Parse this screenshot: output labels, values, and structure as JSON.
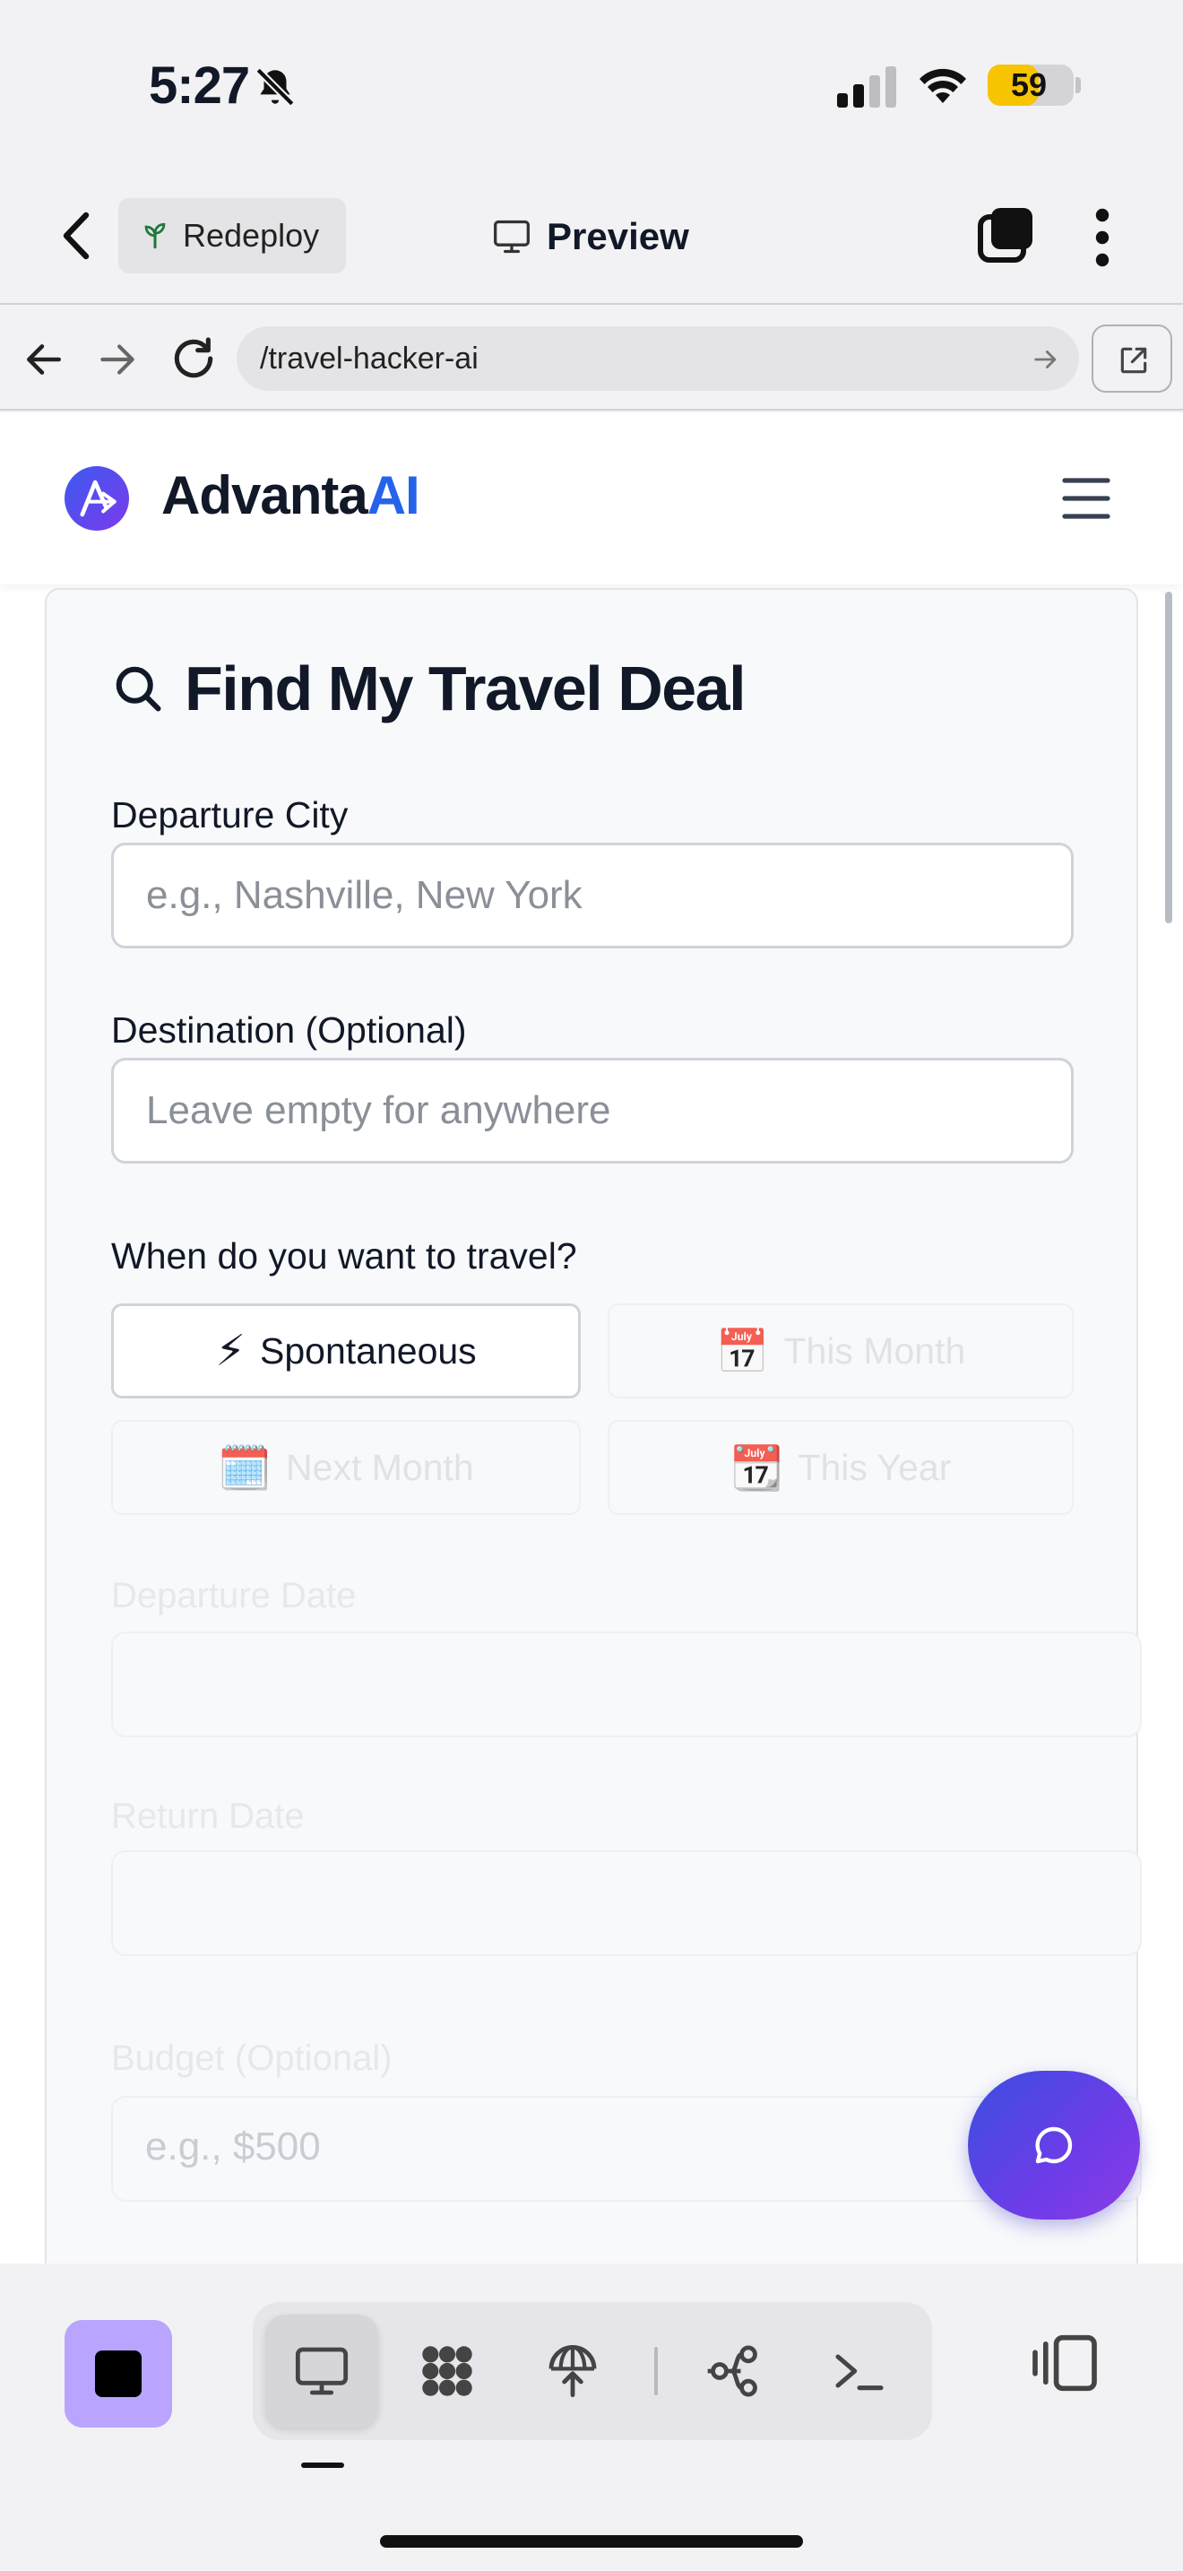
{
  "status_bar": {
    "time": "5:27",
    "battery": "59",
    "battery_level": 0.59
  },
  "app_header": {
    "redeploy_label": "Redeploy",
    "preview_label": "Preview"
  },
  "browser": {
    "url": "/travel-hacker-ai"
  },
  "site": {
    "brand_part1": "Advanta",
    "brand_part2": "AI"
  },
  "form": {
    "title": "Find My Travel Deal",
    "departure_label": "Departure City",
    "departure_placeholder": "e.g., Nashville, New York",
    "destination_label": "Destination (Optional)",
    "destination_placeholder": "Leave empty for anywhere",
    "when_label": "When do you want to travel?",
    "options": [
      {
        "icon": "⚡",
        "label": "Spontaneous",
        "selected": true
      },
      {
        "icon": "📅",
        "label": "This Month",
        "selected": false
      },
      {
        "icon": "🗓️",
        "label": "Next Month",
        "selected": false
      },
      {
        "icon": "📆",
        "label": "This Year",
        "selected": false
      }
    ],
    "departure_date_label": "Departure Date",
    "return_date_label": "Return Date",
    "budget_label": "Budget (Optional)",
    "budget_placeholder": "e.g., $500"
  },
  "icons": {
    "header": [
      "back-chevron-icon",
      "sprout-icon",
      "monitor-icon",
      "tabs-icon",
      "more-vertical-icon"
    ],
    "browser": [
      "arrow-left-icon",
      "arrow-right-icon",
      "reload-icon",
      "go-arrow-icon",
      "external-link-icon"
    ],
    "toolbar": [
      "stop-icon",
      "monitor-icon",
      "grid-dots-icon",
      "deploy-icon",
      "git-branch-icon",
      "terminal-icon",
      "panel-icon"
    ]
  },
  "colors": {
    "accent": "#2563eb",
    "fab_start": "#3b4fe0",
    "fab_end": "#8b3ce6",
    "stop_bg": "#b9a4ff",
    "battery": "#f6c400"
  }
}
